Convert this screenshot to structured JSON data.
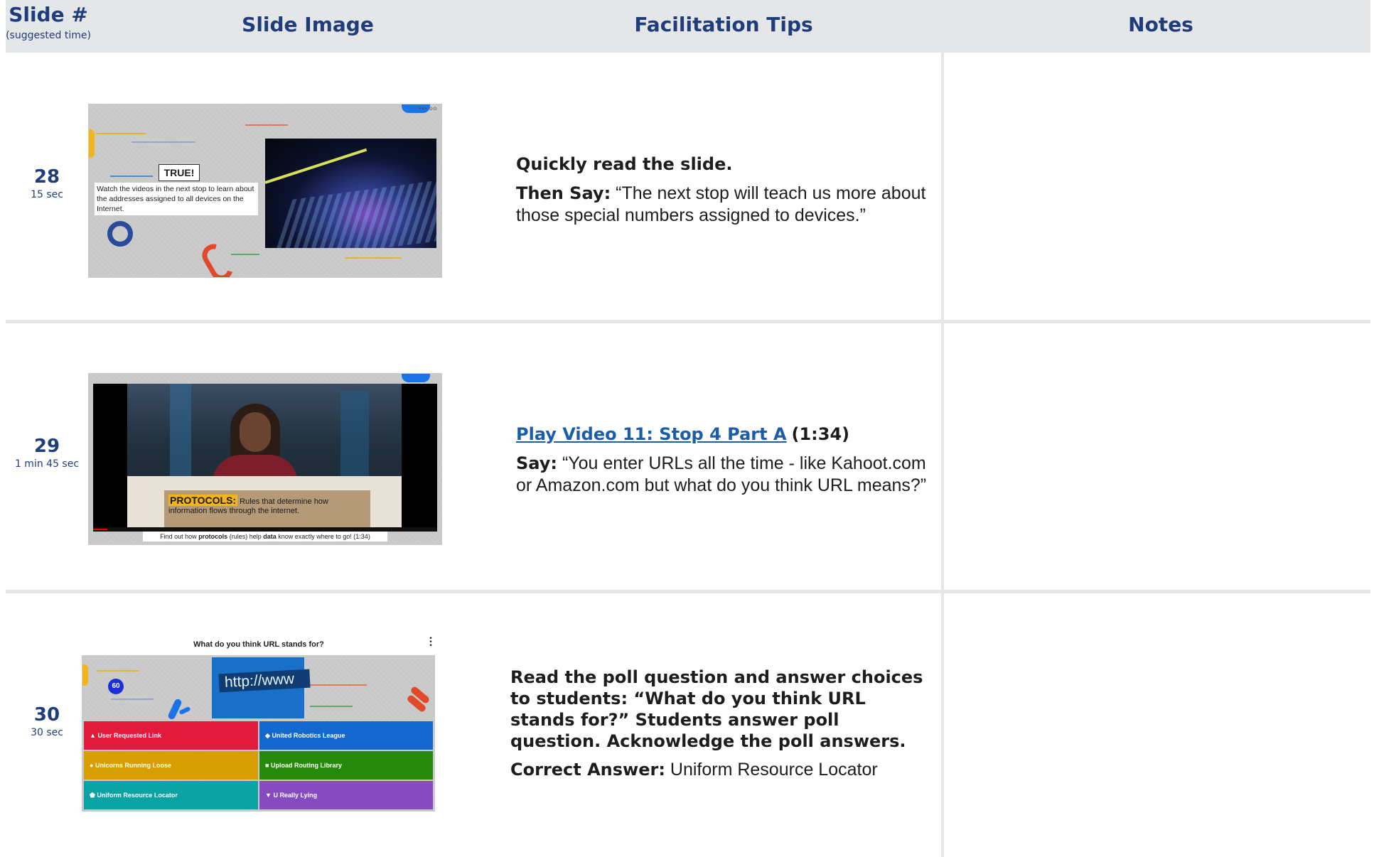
{
  "header": {
    "slide_col": "Slide #",
    "slide_sub": "(suggested time)",
    "image_col": "Slide Image",
    "tips_col": "Facilitation Tips",
    "notes_col": "Notes"
  },
  "rows": [
    {
      "number": "28",
      "time": "15 sec",
      "thumb": {
        "badge": "TRUE!",
        "caption": "Watch the videos in the next stop to learn about the addresses assigned to all devices on the Internet."
      },
      "tip_heading": "Quickly read the slide.",
      "tip_label": "Then Say:",
      "tip_text": "“The next stop will teach us more about those special numbers assigned to devices.”"
    },
    {
      "number": "29",
      "time": "1 min 45 sec",
      "thumb": {
        "term": "PROTOCOLS:",
        "definition": "Rules that determine how information flows through the internet.",
        "caption_pre": "Find out how ",
        "caption_b1": "protocols",
        "caption_mid": " (rules) help ",
        "caption_b2": "data",
        "caption_post": " know exactly where to go! (1:34)"
      },
      "tip_link": "Play Video 11: Stop 4 Part A",
      "tip_duration": "(1:34)",
      "tip_label": "Say:",
      "tip_text": "“You enter URLs all the time - like Kahoot.com or Amazon.com but what do you think URL means?”"
    },
    {
      "number": "30",
      "time": "30 sec",
      "thumb": {
        "question": "What do you think URL stands for?",
        "timer": "60",
        "url_text": "http://www",
        "options": [
          {
            "label": "User Requested Link",
            "symbol": "▲",
            "color": "#e21b3c"
          },
          {
            "label": "United Robotics League",
            "symbol": "◆",
            "color": "#1368ce"
          },
          {
            "label": "Unicorns Running Loose",
            "symbol": "●",
            "color": "#d89e00"
          },
          {
            "label": "Upload Routing Library",
            "symbol": "■",
            "color": "#26890c"
          },
          {
            "label": "Uniform Resource Locator",
            "symbol": "⬟",
            "color": "#0aa3a3"
          },
          {
            "label": "U Really Lying",
            "symbol": "▼",
            "color": "#864cbf"
          }
        ]
      },
      "tip_heading": "Read the poll question and answer choices to students: “What do you think URL stands for?” Students answer poll question. Acknowledge the poll answers.",
      "tip_label": "Correct Answer:",
      "tip_text": "Uniform Resource Locator"
    }
  ],
  "colors": {
    "header_bg": "#e4e6e8",
    "header_text": "#1f3d7a",
    "link": "#1a5da8"
  }
}
